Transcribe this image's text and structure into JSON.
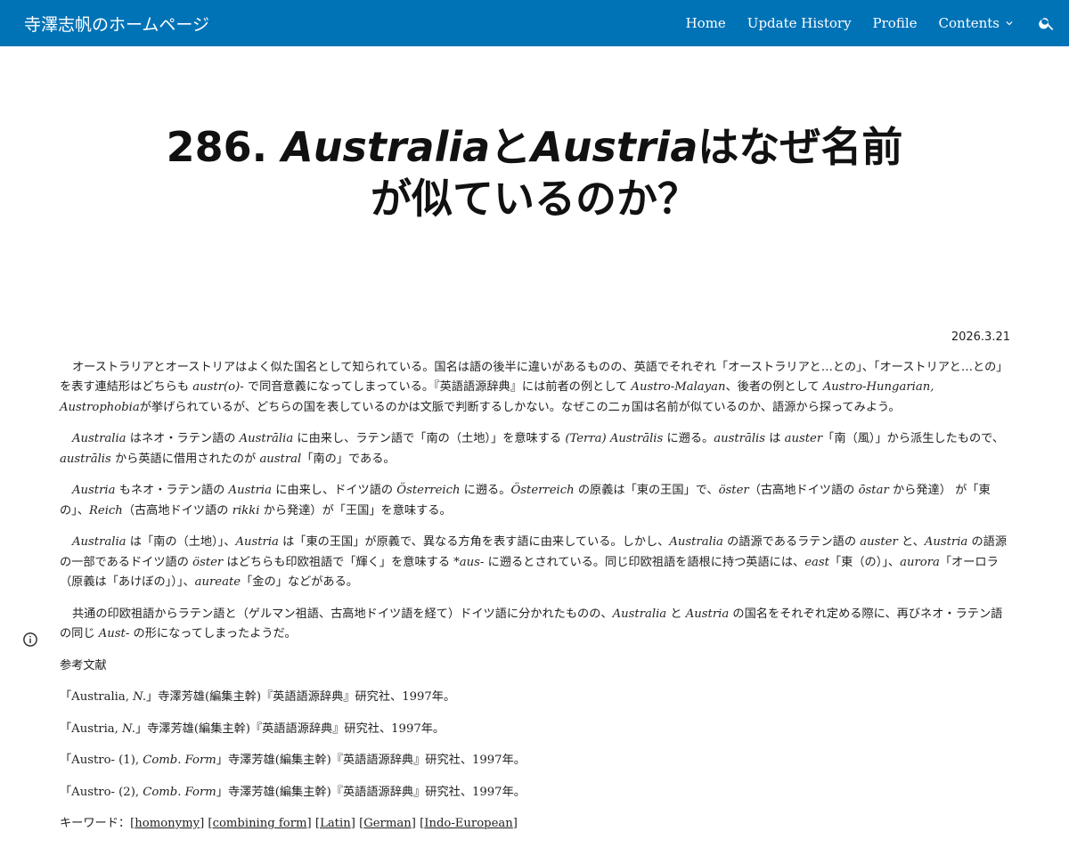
{
  "header": {
    "site_title": "寺澤志帆のホームページ",
    "nav": [
      {
        "label": "Home"
      },
      {
        "label": "Update History"
      },
      {
        "label": "Profile"
      },
      {
        "label": "Contents"
      }
    ]
  },
  "page": {
    "title_line1": "286. AustraliaとAustriaはなぜ名前",
    "title_line2": "が似ているのか？",
    "date": "2026.3.21"
  },
  "paragraphs": [
    {
      "segments": [
        {
          "t": "オーストラリアとオーストリアはよく似た国名として知られている。国名は語の後半に違いがあるものの、英語でそれぞれ「オーストラリアと…との」、「オーストリアと…との」を表す連結形はどちらも "
        },
        {
          "t": "austr(o)-",
          "i": true
        },
        {
          "t": " で同音意義になってしまっている。『英語語源辞典』には前者の例として "
        },
        {
          "t": "Austro-Malayan",
          "i": true
        },
        {
          "t": "、後者の例として "
        },
        {
          "t": "Austro-Hungarian, Austrophobia",
          "i": true
        },
        {
          "t": "が挙げられているが、どちらの国を表しているのかは文脈で判断するしかない。なぜこの二ヵ国は名前が似ているのか、語源から探ってみよう。"
        }
      ]
    },
    {
      "segments": [
        {
          "t": "Australia",
          "i": true
        },
        {
          "t": " はネオ・ラテン語の "
        },
        {
          "t": "Austrālia",
          "i": true
        },
        {
          "t": " に由来し、ラテン語で「南の（土地）」を意味する "
        },
        {
          "t": "(Terra) Austrālis",
          "i": true
        },
        {
          "t": " に遡る。"
        },
        {
          "t": "austrālis",
          "i": true
        },
        {
          "t": " は "
        },
        {
          "t": "auster",
          "i": true
        },
        {
          "t": "「南（風）」から派生したもので、"
        },
        {
          "t": "austrālis",
          "i": true
        },
        {
          "t": " から英語に借用されたのが "
        },
        {
          "t": "austral",
          "i": true
        },
        {
          "t": "「南の」である。"
        }
      ]
    },
    {
      "segments": [
        {
          "t": "Austria",
          "i": true
        },
        {
          "t": " もネオ・ラテン語の "
        },
        {
          "t": "Austria",
          "i": true
        },
        {
          "t": " に由来し、ドイツ語の "
        },
        {
          "t": "Österreich",
          "i": true
        },
        {
          "t": " に遡る。"
        },
        {
          "t": "Österreich",
          "i": true
        },
        {
          "t": " の原義は「東の王国」で、"
        },
        {
          "t": "öster",
          "i": true
        },
        {
          "t": "（古高地ドイツ語の "
        },
        {
          "t": "ōstar",
          "i": true
        },
        {
          "t": " から発達） が「東の」、"
        },
        {
          "t": "Reich",
          "i": true
        },
        {
          "t": "（古高地ドイツ語の "
        },
        {
          "t": "rikki",
          "i": true
        },
        {
          "t": " から発達）が「王国」を意味する。"
        }
      ]
    },
    {
      "segments": [
        {
          "t": "Australia",
          "i": true
        },
        {
          "t": " は「南の（土地）」、"
        },
        {
          "t": "Austria",
          "i": true
        },
        {
          "t": " は「東の王国」が原義で、異なる方角を表す語に由来している。しかし、"
        },
        {
          "t": "Australia",
          "i": true
        },
        {
          "t": " の語源であるラテン語の "
        },
        {
          "t": "auster",
          "i": true
        },
        {
          "t": " と、"
        },
        {
          "t": "Austria",
          "i": true
        },
        {
          "t": " の語源の一部であるドイツ語の "
        },
        {
          "t": "öster",
          "i": true
        },
        {
          "t": " はどちらも印欧祖語で「輝く」を意味する "
        },
        {
          "t": "*aus-",
          "i": true
        },
        {
          "t": " に遡るとされている。同じ印欧祖語を語根に持つ英語には、"
        },
        {
          "t": "east",
          "i": true
        },
        {
          "t": "「東（の）」、"
        },
        {
          "t": "aurora",
          "i": true
        },
        {
          "t": "「オーロラ（原義は「あけぼの」）」、"
        },
        {
          "t": "aureate",
          "i": true
        },
        {
          "t": "「金の」などがある。"
        }
      ]
    },
    {
      "segments": [
        {
          "t": "共通の印欧祖語からラテン語と（ゲルマン祖語、古高地ドイツ語を経て）ドイツ語に分かれたものの、"
        },
        {
          "t": "Australia",
          "i": true
        },
        {
          "t": " と "
        },
        {
          "t": "Austria",
          "i": true
        },
        {
          "t": " の国名をそれぞれ定める際に、再びネオ・ラテン語の同じ "
        },
        {
          "t": "Aust-",
          "i": true
        },
        {
          "t": " の形になってしまったようだ。"
        }
      ]
    }
  ],
  "references": {
    "heading": "参考文献",
    "items": [
      [
        {
          "t": "「Australia, "
        },
        {
          "t": "N.",
          "i": true
        },
        {
          "t": "」寺澤芳雄(編集主幹)『英語語源辞典』研究社、1997年。"
        }
      ],
      [
        {
          "t": "「Austria, "
        },
        {
          "t": "N.",
          "i": true
        },
        {
          "t": "」寺澤芳雄(編集主幹)『英語語源辞典』研究社、1997年。"
        }
      ],
      [
        {
          "t": "「Austro- (1), "
        },
        {
          "t": "Comb. Form",
          "i": true
        },
        {
          "t": "」寺澤芳雄(編集主幹)『英語語源辞典』研究社、1997年。"
        }
      ],
      [
        {
          "t": "「Austro- (2), "
        },
        {
          "t": "Comb. Form",
          "i": true
        },
        {
          "t": "」寺澤芳雄(編集主幹)『英語語源辞典』研究社、1997年。"
        }
      ]
    ]
  },
  "keywords": {
    "label": "キーワード：",
    "items": [
      "homonymy",
      "combining form",
      "Latin",
      "German",
      "Indo-European"
    ]
  },
  "icons": {
    "search": "search-icon",
    "chevron": "chevron-down-icon",
    "info": "info-icon"
  }
}
